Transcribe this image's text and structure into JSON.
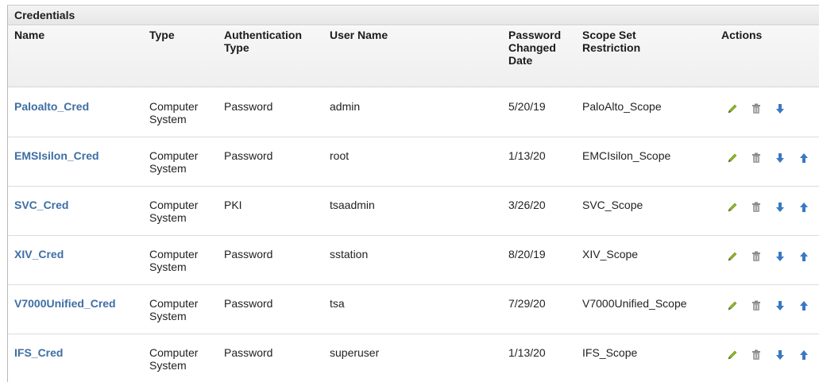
{
  "panel": {
    "title": "Credentials"
  },
  "columns": {
    "name": "Name",
    "type": "Type",
    "auth_type": [
      "Authentication",
      "Type"
    ],
    "user_name": "User Name",
    "pwd_changed": [
      "Password",
      "Changed",
      "Date"
    ],
    "scope": [
      "Scope Set",
      "Restriction"
    ],
    "actions": "Actions"
  },
  "rows": [
    {
      "name": "Paloalto_Cred",
      "type": [
        "Computer",
        "System"
      ],
      "auth": "Password",
      "user": "admin",
      "date": "5/20/19",
      "scope": "PaloAlto_Scope",
      "actions": [
        "edit",
        "delete",
        "move-down"
      ]
    },
    {
      "name": "EMSIsilon_Cred",
      "type": [
        "Computer",
        "System"
      ],
      "auth": "Password",
      "user": "root",
      "date": "1/13/20",
      "scope": "EMCIsilon_Scope",
      "actions": [
        "edit",
        "delete",
        "move-down",
        "move-up"
      ]
    },
    {
      "name": "SVC_Cred",
      "type": [
        "Computer",
        "System"
      ],
      "auth": "PKI",
      "user": "tsaadmin",
      "date": "3/26/20",
      "scope": "SVC_Scope",
      "actions": [
        "edit",
        "delete",
        "move-down",
        "move-up"
      ]
    },
    {
      "name": "XIV_Cred",
      "type": [
        "Computer",
        "System"
      ],
      "auth": "Password",
      "user": "sstation",
      "date": "8/20/19",
      "scope": "XIV_Scope",
      "actions": [
        "edit",
        "delete",
        "move-down",
        "move-up"
      ]
    },
    {
      "name": "V7000Unified_Cred",
      "type": [
        "Computer",
        "System"
      ],
      "auth": "Password",
      "user": "tsa",
      "date": "7/29/20",
      "scope": "V7000Unified_Scope",
      "actions": [
        "edit",
        "delete",
        "move-down",
        "move-up"
      ]
    },
    {
      "name": "IFS_Cred",
      "type": [
        "Computer",
        "System"
      ],
      "auth": "Password",
      "user": "superuser",
      "date": "1/13/20",
      "scope": "IFS_Scope",
      "actions": [
        "edit",
        "delete",
        "move-down",
        "move-up"
      ]
    }
  ],
  "icons": {
    "edit": "pencil-icon",
    "delete": "trash-icon",
    "move-down": "arrow-down-icon",
    "move-up": "arrow-up-icon"
  },
  "colors": {
    "link": "#3d6ea5",
    "pencil": "#8fb52a",
    "trash": "#9a9a9a",
    "arrow": "#3b78c4"
  }
}
